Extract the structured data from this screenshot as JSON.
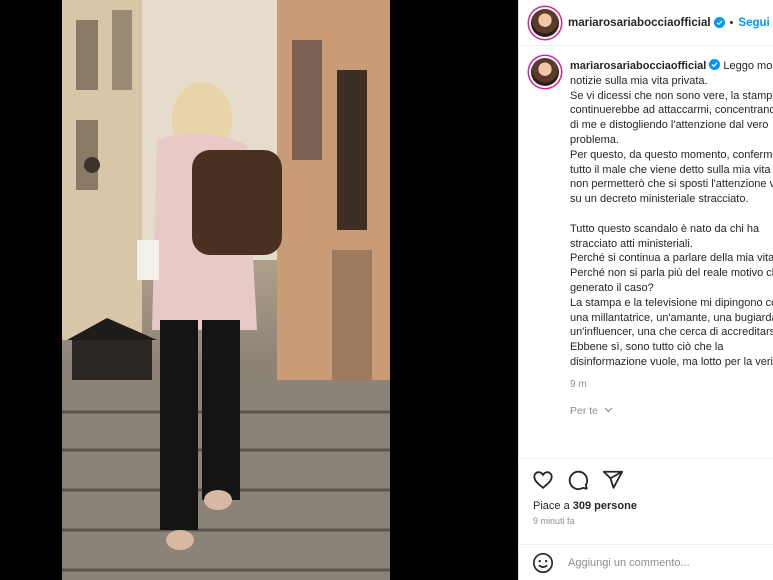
{
  "header": {
    "username": "mariarosariabocciaofficial",
    "separator": "•",
    "follow_label": "Segui"
  },
  "caption": {
    "username": "mariarosariabocciaofficial",
    "text": " Leggo molte notizie sulla mia vita privata.\nSe vi dicessi che non sono vere, la stampa continuerebbe ad attaccarmi, concentrando su di me e distogliendo l'attenzione dal vero problema.\nPer questo, da questo momento, confermo tutto il male che viene detto sulla mia vita ma non permetterò che si sposti l'attenzione verità su un decreto ministeriale stracciato.\n\nTutto questo scandalo è nato da chi ha stracciato atti ministeriali.\nPerché si continua a parlare della mia vita?\nPerché non si parla più del reale motivo che ha generato il caso?\nLa stampa e la televisione mi dipingono come una millantatrice, un'amante, una bugiarda, un'influencer, una che cerca di accreditarsi...\nEbbene sì, sono tutto ciò che la disinformazione vuole, ma lotto per la verità.",
    "time": "9 m",
    "translate_label": "Per te"
  },
  "actions": {
    "likes_prefix": "Piace a ",
    "likes_count": "309 persone",
    "posted_ago": "9 minuti fa"
  },
  "comment": {
    "placeholder": "Aggiungi un commento..."
  },
  "colors": {
    "accent": "#0095f6",
    "verified": "#0095f6",
    "text": "#262626",
    "muted": "#8e8e8e"
  },
  "icons": [
    "verified-badge-icon",
    "heart-icon",
    "comment-icon",
    "share-icon",
    "emoji-icon",
    "chevron-down-icon"
  ]
}
